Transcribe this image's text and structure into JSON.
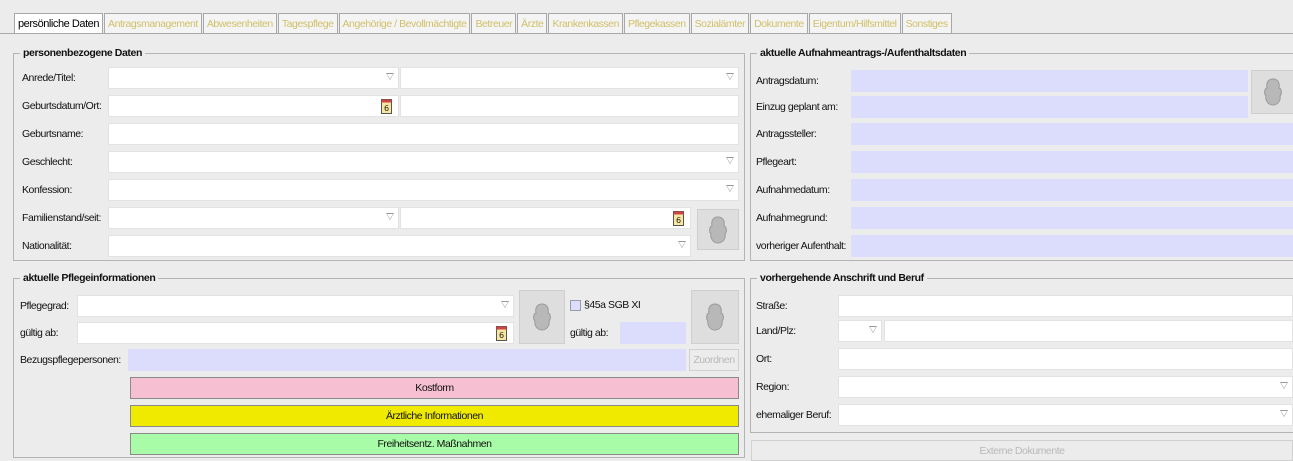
{
  "tabs": [
    "persönliche Daten",
    "Antragsmanagement",
    "Abwesenheiten",
    "Tagespflege",
    "Angehörige / Bevollmächtigte",
    "Betreuer",
    "Ärzte",
    "Krankenkassen",
    "Pflegekassen",
    "Sozialämter",
    "Dokumente",
    "Eigentum/Hilfsmittel",
    "Sonstiges"
  ],
  "personal": {
    "title": "personenbezogene Daten",
    "rows": [
      "Anrede/Titel:",
      "Geburtsdatum/Ort:",
      "Geburtsname:",
      "Geschlecht:",
      "Konfession:",
      "Familienstand/seit:",
      "Nationalität:"
    ]
  },
  "admission": {
    "title": "aktuelle Aufnahmeantrags-/Aufenthaltsdaten",
    "rows": [
      "Antragsdatum:",
      "Einzug geplant am:",
      "Antragssteller:",
      "Pflegeart:",
      "Aufnahmedatum:",
      "Aufnahmegrund:",
      "vorheriger Aufenthalt:"
    ]
  },
  "care": {
    "title": "aktuelle Pflegeinformationen",
    "pflegegrad": "Pflegegrad:",
    "gueltig": "gültig ab:",
    "sgb": "§45a SGB XI",
    "gueltig2": "gültig ab:",
    "bezug": "Bezugspflegepersonen:",
    "zuordnen": "Zuordnen",
    "kostform": "Kostform",
    "aerztlich": "Ärztliche Informationen",
    "frei": "Freiheitsentz. Maßnahmen"
  },
  "address": {
    "title": "vorhergehende Anschrift und Beruf",
    "rows": [
      "Straße:",
      "Land/Plz:",
      "Ort:",
      "Region:",
      "ehemaliger Beruf:"
    ]
  },
  "externe": "Externe Dokumente"
}
